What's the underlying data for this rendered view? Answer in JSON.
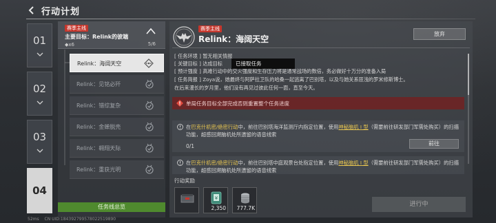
{
  "header": {
    "title": "行动计划"
  },
  "chapters": [
    {
      "number": "01"
    },
    {
      "number": "02"
    },
    {
      "number": "03"
    },
    {
      "number": "04"
    }
  ],
  "quest_list": {
    "main_goal": {
      "tag": "赛季主线",
      "text": "主要目标：Relink的彼端",
      "reward": "◆x6",
      "progress": "5/6"
    },
    "items": [
      {
        "label": "Relink：海阔天空",
        "state": "active"
      },
      {
        "label": "Relink：见铭必歼",
        "state": "done"
      },
      {
        "label": "Relink：错综复杂",
        "state": "done"
      },
      {
        "label": "Relink：金蝉脱壳",
        "state": "done"
      },
      {
        "label": "Relink：翱翔天际",
        "state": "done"
      },
      {
        "label": "Relink：重获光明",
        "state": "done"
      }
    ],
    "overview_button": "任务线总览"
  },
  "detail": {
    "tag": "赛季主线",
    "title": "Relink：海阔天空",
    "abandon_button": "放弃",
    "env": {
      "key": "[ 任务环境 ]",
      "value": "暂无相关情报"
    },
    "target": {
      "key": "[ 关键目标 ]",
      "value": "达成目标"
    },
    "tooltip": "已接取任务",
    "difficulty": {
      "key": "[ 预计强度 ]",
      "value": "高难行动中的交火强度和生存压力将是通常战场的数倍，务必做好十万分的准备入局"
    },
    "brief": {
      "key": "[ 任务简报 ]",
      "line1": "Zoya说，她最终与阿萨拉卫队的哈桑一起逃离了巴别塔，以及与她关系匪浅的罗米修斯博士。",
      "line2": "在后来漫长的岁月里，他们没有再见过彼此任何一面，直至今天。"
    },
    "warning": "单局任务目标全部完成否则重置整个任务进度",
    "tasks": [
      {
        "prefix": "在",
        "mode": "巴克什机密/绝密行动",
        "mid": "中，前往巴别塔海洋监测厅内指定位置，使用",
        "item": "神秘脑机 I 型",
        "suffix": "（需要前往研发部门军需处购买）的扫描功能，超感回溯脑机处所遗留的语音线索",
        "progress": "0/1",
        "button": "前往"
      },
      {
        "prefix": "在",
        "mode": "巴克什机密/绝密行动",
        "mid": "中，前往巴别塔中庭观景台处指定位置，使用",
        "item": "神秘脑机 I 型",
        "suffix": "（需要前往研发部门军需处购买）的扫描功能，超感回溯脑机处所遗留的语音线索"
      }
    ],
    "rewards_label": "行动奖励",
    "rewards": [
      {
        "icon": "ammo-box-icon",
        "count": ""
      },
      {
        "icon": "money-box-icon",
        "count": "2,350"
      },
      {
        "icon": "coin-stack-icon",
        "count": "777.7K"
      }
    ],
    "in_progress_button": "进行中"
  },
  "footer": {
    "latency": "52ms",
    "uid": "CN UID:184392799578022519890"
  }
}
